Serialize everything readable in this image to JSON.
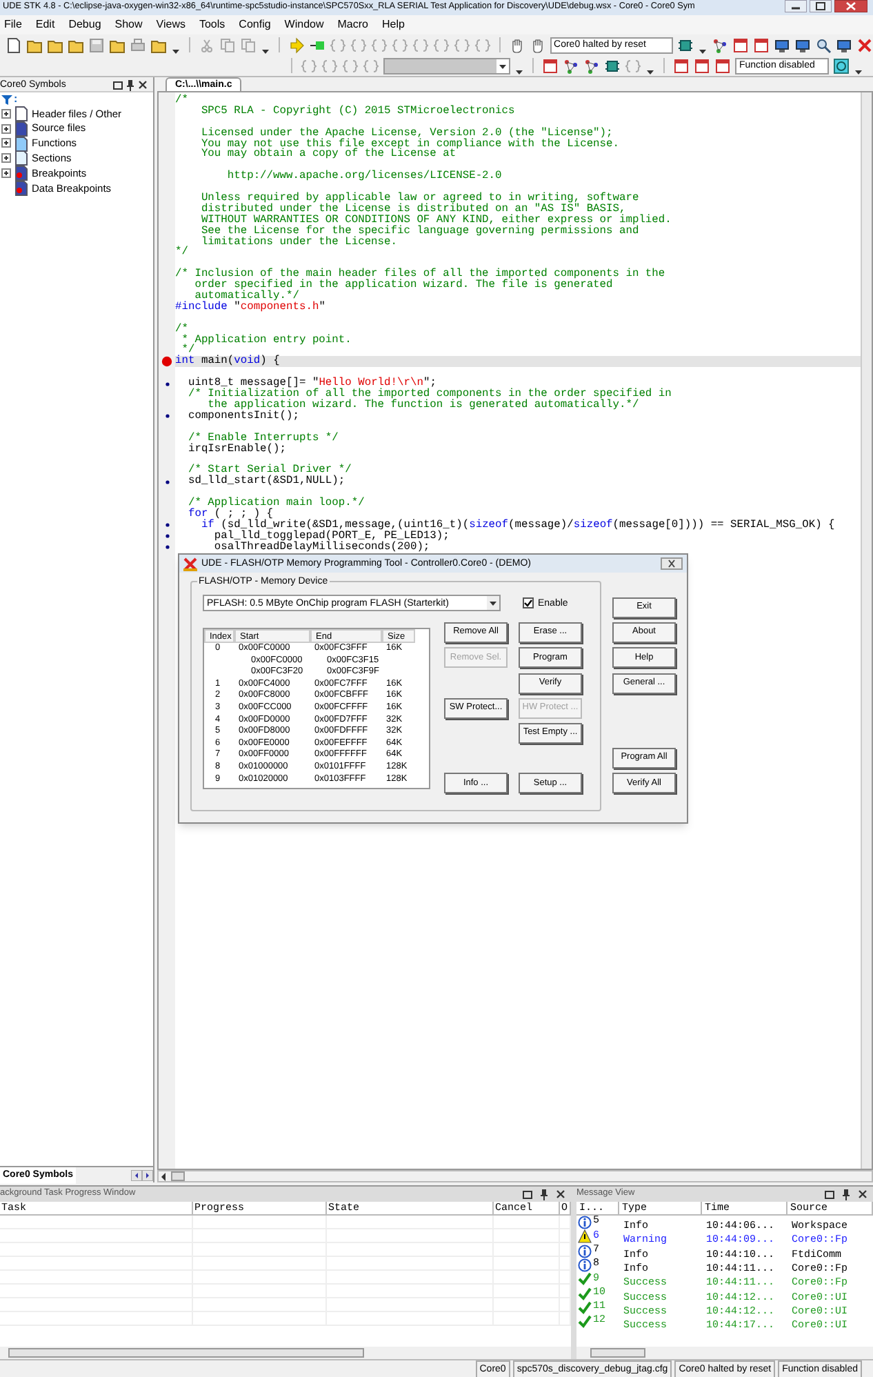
{
  "window": {
    "title": "UDE STK 4.8 - C:\\eclipse-java-oxygen-win32-x86_64\\runtime-spc5studio-instance\\SPC570Sxx_RLA SERIAL Test Application for Discovery\\UDE\\debug.wsx - Core0 - Core0 Sym"
  },
  "menu": [
    "File",
    "Edit",
    "Debug",
    "Show",
    "Views",
    "Tools",
    "Config",
    "Window",
    "Macro",
    "Help"
  ],
  "toolbar": {
    "status_field": "Core0 halted by reset",
    "function_field": "Function disabled"
  },
  "symbols_panel": {
    "title": "Core0 Symbols",
    "filter": ":",
    "items": [
      {
        "label": "Header files / Other",
        "kind": "header",
        "expandable": true
      },
      {
        "label": "Source files",
        "kind": "source",
        "expandable": true
      },
      {
        "label": "Functions",
        "kind": "function",
        "expandable": true
      },
      {
        "label": "Sections",
        "kind": "section",
        "expandable": true
      },
      {
        "label": "Breakpoints",
        "kind": "breakpoint",
        "expandable": true
      },
      {
        "label": "Data Breakpoints",
        "kind": "breakpoint",
        "expandable": false
      }
    ],
    "tabs": [
      {
        "label": "Core0 Symbols",
        "selected": true
      }
    ]
  },
  "editor": {
    "tabs": [
      {
        "label": "C:\\...\\\\main.c",
        "selected": true
      }
    ],
    "lines": [
      {
        "kind": "line",
        "current": false,
        "segments": [
          {
            "kind": "comment",
            "text": "/*"
          }
        ]
      },
      {
        "kind": "line",
        "current": false,
        "segments": [
          {
            "kind": "comment",
            "text": "    SPC5 RLA - Copyright (C) 2015 STMicroelectronics"
          }
        ]
      },
      {
        "kind": "line",
        "current": false
      },
      {
        "kind": "line",
        "current": false,
        "segments": [
          {
            "kind": "comment",
            "text": "    Licensed under the Apache License, Version 2.0 (the \"License\");"
          }
        ]
      },
      {
        "kind": "line",
        "current": false,
        "segments": [
          {
            "kind": "comment",
            "text": "    You may not use this file except in compliance with the License."
          }
        ]
      },
      {
        "kind": "line",
        "current": false,
        "segments": [
          {
            "kind": "comment",
            "text": "    You may obtain a copy of the License at"
          }
        ]
      },
      {
        "kind": "line",
        "current": false
      },
      {
        "kind": "line",
        "current": false,
        "segments": [
          {
            "kind": "comment",
            "text": "        http://www.apache.org/licenses/LICENSE-2.0"
          }
        ]
      },
      {
        "kind": "line",
        "current": false
      },
      {
        "kind": "line",
        "current": false,
        "segments": [
          {
            "kind": "comment",
            "text": "    Unless required by applicable law or agreed to in writing, software"
          }
        ]
      },
      {
        "kind": "line",
        "current": false,
        "segments": [
          {
            "kind": "comment",
            "text": "    distributed under the License is distributed on an \"AS IS\" BASIS,"
          }
        ]
      },
      {
        "kind": "line",
        "current": false,
        "segments": [
          {
            "kind": "comment",
            "text": "    WITHOUT WARRANTIES OR CONDITIONS OF ANY KIND, either express or implied."
          }
        ]
      },
      {
        "kind": "line",
        "current": false,
        "segments": [
          {
            "kind": "comment",
            "text": "    See the License for the specific language governing permissions and"
          }
        ]
      },
      {
        "kind": "line",
        "current": false,
        "segments": [
          {
            "kind": "comment",
            "text": "    limitations under the License."
          }
        ]
      },
      {
        "kind": "line",
        "current": false,
        "segments": [
          {
            "kind": "comment",
            "text": "*/"
          }
        ]
      },
      {
        "kind": "line",
        "current": false
      },
      {
        "kind": "line",
        "current": false,
        "segments": [
          {
            "kind": "comment",
            "text": "/* Inclusion of the main header files of all the imported components in the"
          }
        ]
      },
      {
        "kind": "line",
        "current": false,
        "segments": [
          {
            "kind": "comment",
            "text": "   order specified in the application wizard. The file is generated"
          }
        ]
      },
      {
        "kind": "line",
        "current": false,
        "segments": [
          {
            "kind": "comment",
            "text": "   automatically.*/"
          }
        ]
      },
      {
        "kind": "line",
        "current": false,
        "segments": [
          {
            "kind": "keyword",
            "text": "#include"
          },
          {
            "kind": "plain",
            "text": " \""
          },
          {
            "kind": "string",
            "text": "components.h"
          },
          {
            "kind": "plain",
            "text": "\""
          }
        ]
      },
      {
        "kind": "line",
        "current": false
      },
      {
        "kind": "line",
        "current": false,
        "segments": [
          {
            "kind": "comment",
            "text": "/*"
          }
        ]
      },
      {
        "kind": "line",
        "current": false,
        "segments": [
          {
            "kind": "comment",
            "text": " * Application entry point."
          }
        ]
      },
      {
        "kind": "line",
        "current": false,
        "segments": [
          {
            "kind": "comment",
            "text": " */"
          }
        ]
      },
      {
        "kind": "breakpoint",
        "current": true,
        "segments": [
          {
            "kind": "keyword",
            "text": "int"
          },
          {
            "kind": "plain",
            "text": " main("
          },
          {
            "kind": "keyword",
            "text": "void"
          },
          {
            "kind": "plain",
            "text": ") {"
          }
        ]
      },
      {
        "kind": "line",
        "current": false
      },
      {
        "kind": "statement",
        "current": false,
        "segments": [
          {
            "kind": "plain",
            "text": "  uint8_t message[]= \""
          },
          {
            "kind": "string",
            "text": "Hello World!\\r\\n"
          },
          {
            "kind": "plain",
            "text": "\";"
          }
        ]
      },
      {
        "kind": "line",
        "current": false,
        "segments": [
          {
            "kind": "comment",
            "text": "  /* Initialization of all the imported components in the order specified in"
          }
        ]
      },
      {
        "kind": "line",
        "current": false,
        "segments": [
          {
            "kind": "comment",
            "text": "     the application wizard. The function is generated automatically.*/"
          }
        ]
      },
      {
        "kind": "statement",
        "current": false,
        "segments": [
          {
            "kind": "plain",
            "text": "  componentsInit();"
          }
        ]
      },
      {
        "kind": "line",
        "current": false
      },
      {
        "kind": "line",
        "current": false,
        "segments": [
          {
            "kind": "comment",
            "text": "  /* Enable Interrupts */"
          }
        ]
      },
      {
        "kind": "line",
        "current": false,
        "segments": [
          {
            "kind": "plain",
            "text": "  irqIsrEnable();"
          }
        ]
      },
      {
        "kind": "line",
        "current": false
      },
      {
        "kind": "line",
        "current": false,
        "segments": [
          {
            "kind": "comment",
            "text": "  /* Start Serial Driver */"
          }
        ]
      },
      {
        "kind": "statement",
        "current": false,
        "segments": [
          {
            "kind": "plain",
            "text": "  sd_lld_start(&SD1,NULL);"
          }
        ]
      },
      {
        "kind": "line",
        "current": false
      },
      {
        "kind": "line",
        "current": false,
        "segments": [
          {
            "kind": "comment",
            "text": "  /* Application main loop.*/"
          }
        ]
      },
      {
        "kind": "line",
        "current": false,
        "segments": [
          {
            "kind": "keyword",
            "text": "  for"
          },
          {
            "kind": "plain",
            "text": " ( ; ; ) {"
          }
        ]
      },
      {
        "kind": "statement",
        "current": false,
        "segments": [
          {
            "kind": "keyword",
            "text": "    if"
          },
          {
            "kind": "plain",
            "text": " (sd_lld_write(&SD1,message,(uint16_t)("
          },
          {
            "kind": "keyword",
            "text": "sizeof"
          },
          {
            "kind": "plain",
            "text": "(message)/"
          },
          {
            "kind": "keyword",
            "text": "sizeof"
          },
          {
            "kind": "plain",
            "text": "(message[0]))) == SERIAL_MSG_OK) {"
          }
        ]
      },
      {
        "kind": "statement",
        "current": false,
        "segments": [
          {
            "kind": "plain",
            "text": "      pal_lld_togglepad(PORT_E, PE_LED13);"
          }
        ]
      },
      {
        "kind": "statement",
        "current": false,
        "segments": [
          {
            "kind": "plain",
            "text": "      osalThreadDelayMilliseconds(200);"
          }
        ]
      }
    ]
  },
  "flash_dialog": {
    "title": "UDE - FLASH/OTP Memory Programming Tool  - Controller0.Core0 - (DEMO)",
    "group": "FLASH/OTP - Memory Device",
    "device": "PFLASH: 0.5 MByte OnChip program FLASH (Starterkit)",
    "enable": {
      "label": "Enable",
      "checked": true
    },
    "columns": [
      "Index",
      "Start",
      "End",
      "Size"
    ],
    "rows": [
      {
        "kind": "sector",
        "index": "0",
        "start": "0x00FC0000",
        "end": "0x00FC3FFF",
        "size": "16K"
      },
      {
        "kind": "range",
        "start": "0x00FC0000",
        "end": "0x00FC3F15"
      },
      {
        "kind": "range",
        "start": "0x00FC3F20",
        "end": "0x00FC3F9F"
      },
      {
        "kind": "sector",
        "index": "1",
        "start": "0x00FC4000",
        "end": "0x00FC7FFF",
        "size": "16K"
      },
      {
        "kind": "sector",
        "index": "2",
        "start": "0x00FC8000",
        "end": "0x00FCBFFF",
        "size": "16K"
      },
      {
        "kind": "sector",
        "index": "3",
        "start": "0x00FCC000",
        "end": "0x00FCFFFF",
        "size": "16K"
      },
      {
        "kind": "sector",
        "index": "4",
        "start": "0x00FD0000",
        "end": "0x00FD7FFF",
        "size": "32K"
      },
      {
        "kind": "sector",
        "index": "5",
        "start": "0x00FD8000",
        "end": "0x00FDFFFF",
        "size": "32K"
      },
      {
        "kind": "sector",
        "index": "6",
        "start": "0x00FE0000",
        "end": "0x00FEFFFF",
        "size": "64K"
      },
      {
        "kind": "sector",
        "index": "7",
        "start": "0x00FF0000",
        "end": "0x00FFFFFF",
        "size": "64K"
      },
      {
        "kind": "sector",
        "index": "8",
        "start": "0x01000000",
        "end": "0x0101FFFF",
        "size": "128K"
      },
      {
        "kind": "sector",
        "index": "9",
        "start": "0x01020000",
        "end": "0x0103FFFF",
        "size": "128K"
      }
    ],
    "button_columns": [
      [
        {
          "label": "Remove All",
          "disabled": false
        },
        {
          "label": "Remove Sel.",
          "disabled": true
        },
        {
          "label": "SW Protect...",
          "disabled": false
        },
        {
          "label": "Info ...",
          "disabled": false
        }
      ],
      [
        {
          "label": "Erase ...",
          "disabled": false
        },
        {
          "label": "Program",
          "disabled": false
        },
        {
          "label": "Verify",
          "disabled": false
        },
        {
          "label": "HW Protect ...",
          "disabled": true
        },
        {
          "label": "Test Empty ...",
          "disabled": false
        },
        {
          "label": "Setup ...",
          "disabled": false
        }
      ],
      [
        {
          "label": "Exit",
          "disabled": false
        },
        {
          "label": "About",
          "disabled": false
        },
        {
          "label": "Help",
          "disabled": false
        },
        {
          "label": "General ...",
          "disabled": false
        },
        {
          "label": "Program All",
          "disabled": false
        },
        {
          "label": "Verify All",
          "disabled": false
        }
      ]
    ]
  },
  "task_window": {
    "title": "ackground Task Progress Window",
    "columns": [
      "Task",
      "Progress",
      "State",
      "Cancel",
      "O"
    ]
  },
  "message_view": {
    "title": "Message View",
    "columns": [
      "I...",
      "Type",
      "Time",
      "Source"
    ],
    "rows": [
      {
        "kind": "info",
        "id": "5",
        "type": "Info",
        "time": "10:44:06...",
        "source": "Workspace"
      },
      {
        "kind": "warning",
        "id": "6",
        "type": "Warning",
        "time": "10:44:09...",
        "source": "Core0::Fp"
      },
      {
        "kind": "info",
        "id": "7",
        "type": "Info",
        "time": "10:44:10...",
        "source": "FtdiComm"
      },
      {
        "kind": "info",
        "id": "8",
        "type": "Info",
        "time": "10:44:11...",
        "source": "Core0::Fp"
      },
      {
        "kind": "success",
        "id": "9",
        "type": "Success",
        "time": "10:44:11...",
        "source": "Core0::Fp"
      },
      {
        "kind": "success",
        "id": "10",
        "type": "Success",
        "time": "10:44:12...",
        "source": "Core0::UI"
      },
      {
        "kind": "success",
        "id": "11",
        "type": "Success",
        "time": "10:44:12...",
        "source": "Core0::UI"
      },
      {
        "kind": "success",
        "id": "12",
        "type": "Success",
        "time": "10:44:17...",
        "source": "Core0::UI"
      }
    ]
  },
  "status_bar": [
    "Core0",
    "spc570s_discovery_debug_jtag.cfg",
    "Core0 halted by reset",
    "Function disabled"
  ]
}
